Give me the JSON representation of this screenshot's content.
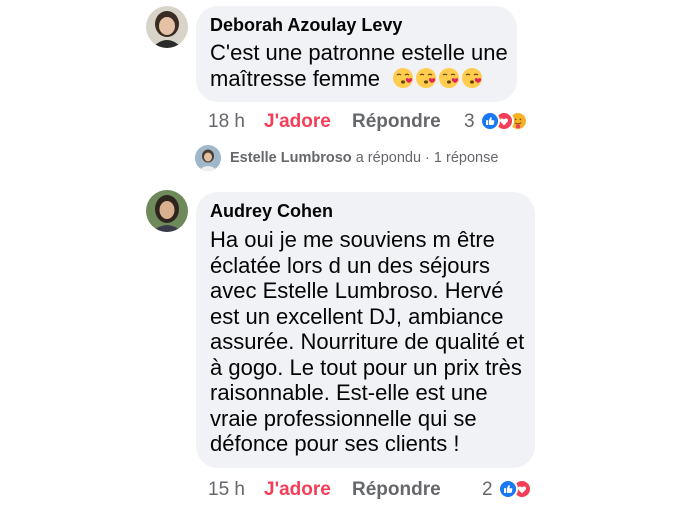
{
  "comments": [
    {
      "author": "Deborah Azoulay Levy",
      "lines": [
        "C'est une patronne estelle une",
        "maîtresse femme"
      ],
      "emoji": [
        "kissing-face-icon",
        "kissing-face-icon",
        "kissing-face-icon",
        "kissing-face-icon"
      ],
      "time": "18 h",
      "like_label": "J'adore",
      "reply_label": "Répondre",
      "reaction_count": "3",
      "reactions": [
        "like-reaction-icon",
        "love-reaction-icon",
        "care-reaction-icon"
      ]
    },
    {
      "author": "Audrey Cohen",
      "lines": [
        "Ha oui je me souviens m être",
        "éclatée lors d un des séjours",
        "avec Estelle Lumbroso. Hervé",
        "est un excellent DJ, ambiance",
        "assurée. Nourriture de qualité et",
        "à gogo. Le tout pour un prix très",
        "raisonnable. Est-elle est une",
        "vraie professionnelle qui se",
        "défonce pour ses clients !"
      ],
      "time": "15 h",
      "like_label": "J'adore",
      "reply_label": "Répondre",
      "reaction_count": "2",
      "reactions": [
        "like-reaction-icon",
        "love-reaction-icon"
      ]
    }
  ],
  "reply_summary": {
    "name": "Estelle Lumbroso",
    "action": "a répondu",
    "separator": " · ",
    "count": "1 réponse"
  },
  "colors": {
    "bubble": "#f0f2f5",
    "meta_text": "#65676b",
    "love_active": "#f33e58",
    "like_blue": "#1877f2",
    "love_red": "#f33e58"
  }
}
